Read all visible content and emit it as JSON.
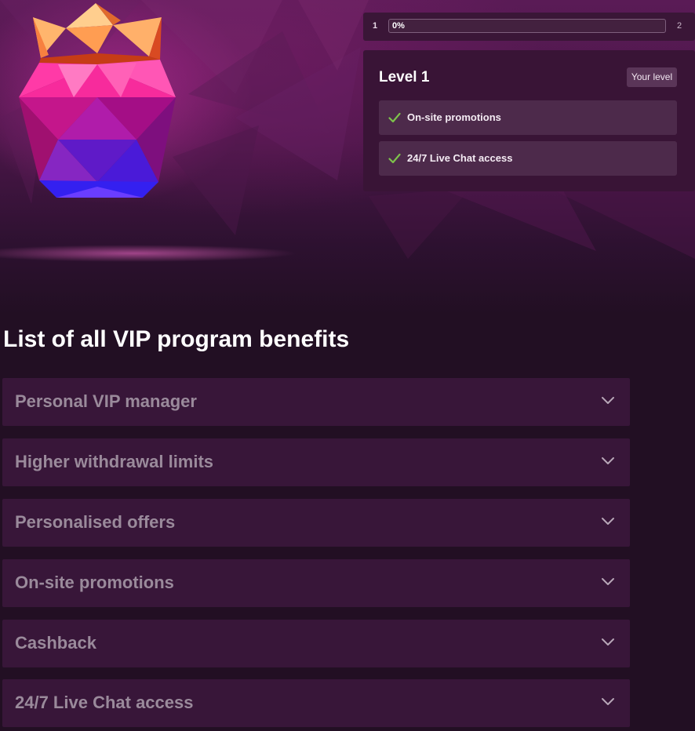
{
  "progress": {
    "current_level_number": "1",
    "next_level_number": "2",
    "percent_label": "0%",
    "fraction": 0.0
  },
  "level_card": {
    "title": "Level 1",
    "badge": "Your level",
    "perks": [
      {
        "label": "On-site promotions",
        "icon": "check-icon"
      },
      {
        "label": "24/7 Live Chat access",
        "icon": "check-icon"
      }
    ]
  },
  "benefits_section": {
    "heading": "List of all VIP program benefits",
    "items": [
      {
        "label": "Personal VIP manager",
        "icon": "chevron-down-icon"
      },
      {
        "label": "Higher withdrawal limits",
        "icon": "chevron-down-icon"
      },
      {
        "label": "Personalised offers",
        "icon": "chevron-down-icon"
      },
      {
        "label": "On-site promotions",
        "icon": "chevron-down-icon"
      },
      {
        "label": "Cashback",
        "icon": "chevron-down-icon"
      },
      {
        "label": "24/7 Live Chat access",
        "icon": "chevron-down-icon"
      }
    ]
  },
  "colors": {
    "page_background": "#220f23",
    "panel_background": "#391436",
    "check_green": "#7dc24b",
    "accordion_background": "#381639",
    "accordion_text": "#9a8a9b"
  }
}
